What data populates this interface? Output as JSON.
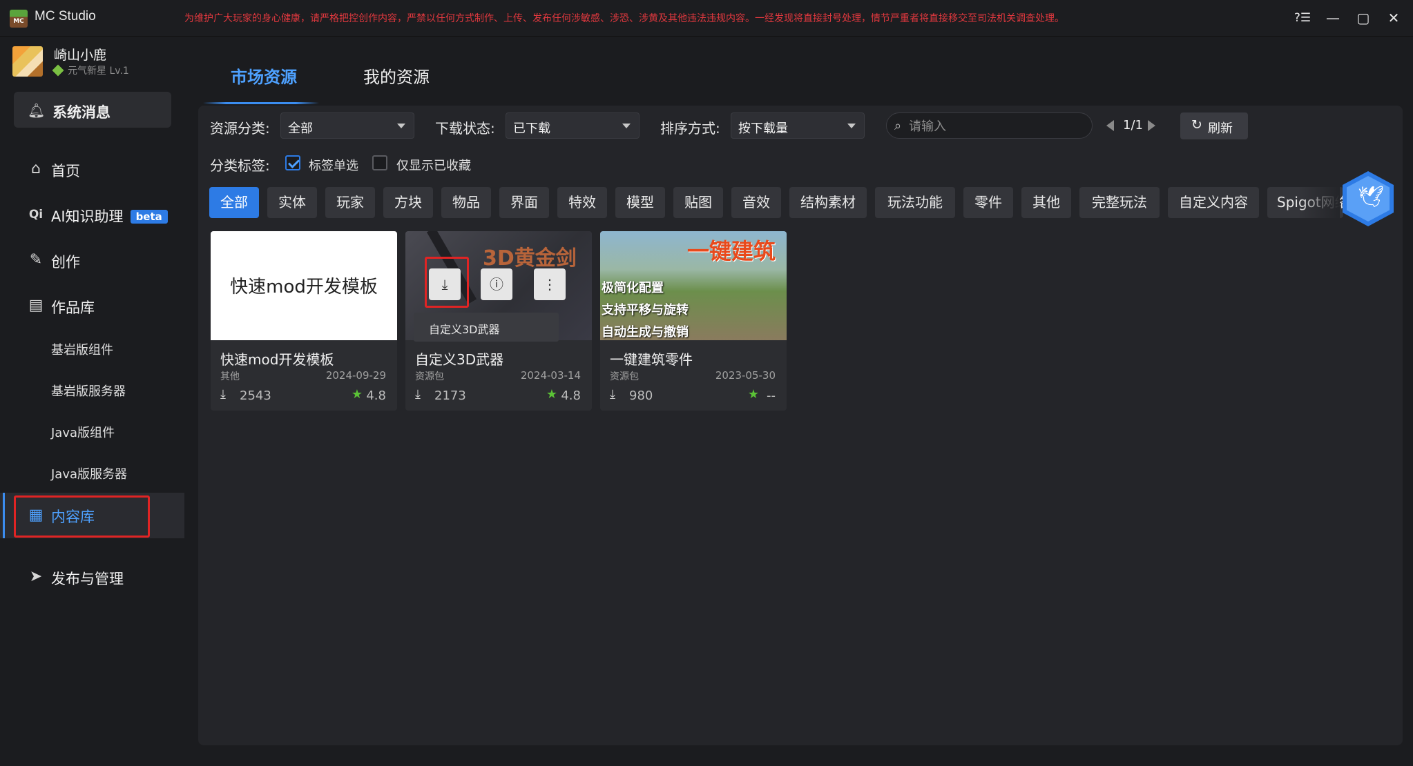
{
  "app": {
    "title": "MC Studio",
    "logo_text": "MC",
    "warning": "为维护广大玩家的身心健康，请严格把控创作内容，严禁以任何方式制作、上传、发布任何涉敏感、涉恐、涉黄及其他违法违规内容。一经发现将直接封号处理，情节严重者将直接移交至司法机关调查处理。",
    "controls": {
      "help": "?☰",
      "minimize": "—",
      "maximize": "▢",
      "close": "✕"
    }
  },
  "user": {
    "name": "崎山小鹿",
    "level": "元气新星 Lv.1"
  },
  "sidebar": {
    "system_message": "系统消息",
    "items": [
      {
        "label": "首页",
        "icon": "home-icon"
      },
      {
        "label": "AI知识助理",
        "badge": "beta",
        "icon": "ai-icon"
      },
      {
        "label": "创作",
        "icon": "pencil-icon"
      },
      {
        "label": "作品库",
        "icon": "library-icon"
      },
      {
        "label": "内容库",
        "icon": "grid-icon",
        "active": true
      },
      {
        "label": "发布与管理",
        "icon": "send-icon"
      }
    ],
    "sub_items": [
      "基岩版组件",
      "基岩版服务器",
      "Java版组件",
      "Java版服务器"
    ],
    "ai_icon_text": "Qi"
  },
  "tabs": [
    "市场资源",
    "我的资源"
  ],
  "filters": {
    "category_label": "资源分类:",
    "category_value": "全部",
    "download_label": "下载状态:",
    "download_value": "已下载",
    "sort_label": "排序方式:",
    "sort_value": "按下载量",
    "search_placeholder": "请输入",
    "page": "1/1",
    "refresh": "刷新",
    "tag_label": "分类标签:",
    "single_tag": "标签单选",
    "only_fav": "仅显示已收藏"
  },
  "chips": [
    "全部",
    "实体",
    "玩家",
    "方块",
    "物品",
    "界面",
    "特效",
    "模型",
    "贴图",
    "音效",
    "结构素材",
    "玩法功能",
    "零件",
    "其他",
    "完整玩法",
    "自定义内容",
    "Spigot网络"
  ],
  "cards": [
    {
      "thumb_text": "快速mod开发模板",
      "name": "快速mod开发模板",
      "category": "其他",
      "date": "2024-09-29",
      "downloads": "2543",
      "rating": "4.8"
    },
    {
      "thumb_text": "3D黄金剑",
      "name": "自定义3D武器",
      "category": "资源包",
      "date": "2024-03-14",
      "downloads": "2173",
      "rating": "4.8",
      "tooltip": "自定义3D武器"
    },
    {
      "thumb_head": "一键建筑",
      "thumb_lines": [
        "极简化配置",
        "支持平移与旋转",
        "自动生成与撤销"
      ],
      "name": "一键建筑零件",
      "category": "资源包",
      "date": "2023-05-30",
      "downloads": "980",
      "rating": "--"
    }
  ],
  "colors": {
    "accent": "#2d7be5",
    "highlight": "#e02424",
    "warning": "#e0383e",
    "star": "#5bc236"
  }
}
